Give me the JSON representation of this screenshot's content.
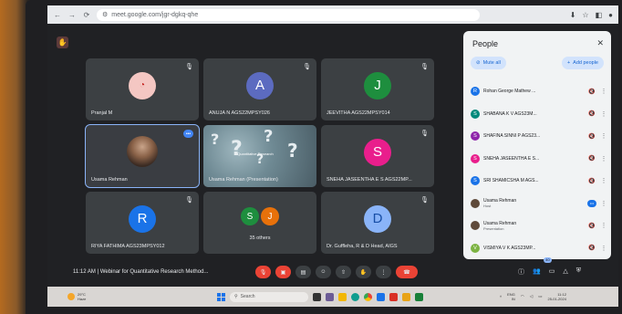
{
  "browser": {
    "url": "meet.google.com/jgr-dgkq-qhe",
    "nav": [
      "←",
      "→",
      "⟳"
    ]
  },
  "meet": {
    "tiles": [
      {
        "name": "Pranjal M",
        "type": "avatar-image",
        "color": "#f4c7c3"
      },
      {
        "name": "ANUJA N AGS22MPSY026",
        "type": "letter",
        "letter": "A",
        "color": "#5c6bc0"
      },
      {
        "name": "JEEVITHA AGS22MPSY014",
        "type": "letter",
        "letter": "J",
        "color": "#1e8e3e"
      },
      {
        "name": "Usama Rehman",
        "type": "video"
      },
      {
        "name": "Usama Rehman (Presentation)",
        "type": "presentation",
        "caption": "Quantitative Research"
      },
      {
        "name": "SNEHA JASEENTHA E S AGS22MP...",
        "type": "letter",
        "letter": "S",
        "color": "#e91e8c"
      },
      {
        "name": "RIYA FATHIMA AGS23MPSY012",
        "type": "letter",
        "letter": "R",
        "color": "#1a73e8"
      },
      {
        "name": "35 others",
        "type": "others",
        "letters": [
          "S",
          "J"
        ],
        "colors": [
          "#1e8e3e",
          "#e8710a"
        ]
      },
      {
        "name": "Dr. Guffleha, R & D Head, AIGS",
        "type": "letter",
        "letter": "D",
        "color": "#8ab4f8"
      }
    ]
  },
  "people_panel": {
    "title": "People",
    "mute_all": "Mute all",
    "add_people": "Add people",
    "participants": [
      {
        "name": "Rohan George Mathew ...",
        "letter": "R",
        "color": "#1a73e8",
        "sub": ""
      },
      {
        "name": "SHABANA K V AGS23M...",
        "letter": "S",
        "color": "#00897b",
        "sub": ""
      },
      {
        "name": "SHAFINA SINNI P AGS23...",
        "letter": "S",
        "color": "#8e24aa",
        "sub": ""
      },
      {
        "name": "SNEHA JASEENTHA E S...",
        "letter": "S",
        "color": "#e91e8c",
        "sub": ""
      },
      {
        "name": "SRI SHAMICSHA M AGS...",
        "letter": "S",
        "color": "#1a73e8",
        "sub": ""
      },
      {
        "name": "Usama Rehman",
        "letter": "",
        "color": "#5f4a3a",
        "sub": "Host"
      },
      {
        "name": "Usama Rehman",
        "letter": "",
        "color": "#5f4a3a",
        "sub": "Presentation"
      },
      {
        "name": "VISMIYA V K AGS23MP...",
        "letter": "V",
        "color": "#7cb342",
        "sub": ""
      }
    ]
  },
  "toolbar": {
    "time": "11:12 AM",
    "separator": "|",
    "meeting_title": "Webinar for Quantitative Research Method...",
    "people_badge": "40"
  },
  "taskbar": {
    "weather_temp": "29°C",
    "weather_desc": "Haze",
    "search_placeholder": "Search",
    "lang": "ENG",
    "lang2": "IN",
    "time": "11:12",
    "date": "25-01-2024"
  }
}
